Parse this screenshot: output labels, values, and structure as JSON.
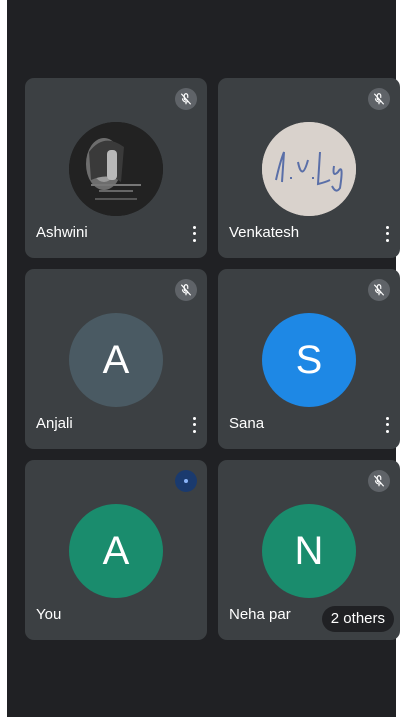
{
  "participants": [
    {
      "name": "Ashwini",
      "avatar_icon": "photo-avatar-portrait",
      "muted": true
    },
    {
      "name": "Venkatesh",
      "avatar_icon": "photo-avatar-signature",
      "muted": true
    },
    {
      "name": "Anjali",
      "initial": "A",
      "avatar_color": "#4a5a63",
      "muted": true
    },
    {
      "name": "Sana",
      "initial": "S",
      "avatar_color": "#1e88e5",
      "muted": true
    },
    {
      "name": "You",
      "initial": "A",
      "avatar_color": "#1a8c6d",
      "muted": false
    },
    {
      "name": "Neha par",
      "initial": "N",
      "avatar_color": "#1a8c6d",
      "muted": true
    }
  ],
  "others_chip": {
    "label": "2 others"
  },
  "colors": {
    "background": "#202124",
    "tile": "#3c4043",
    "mute_badge": "#5f6368"
  }
}
